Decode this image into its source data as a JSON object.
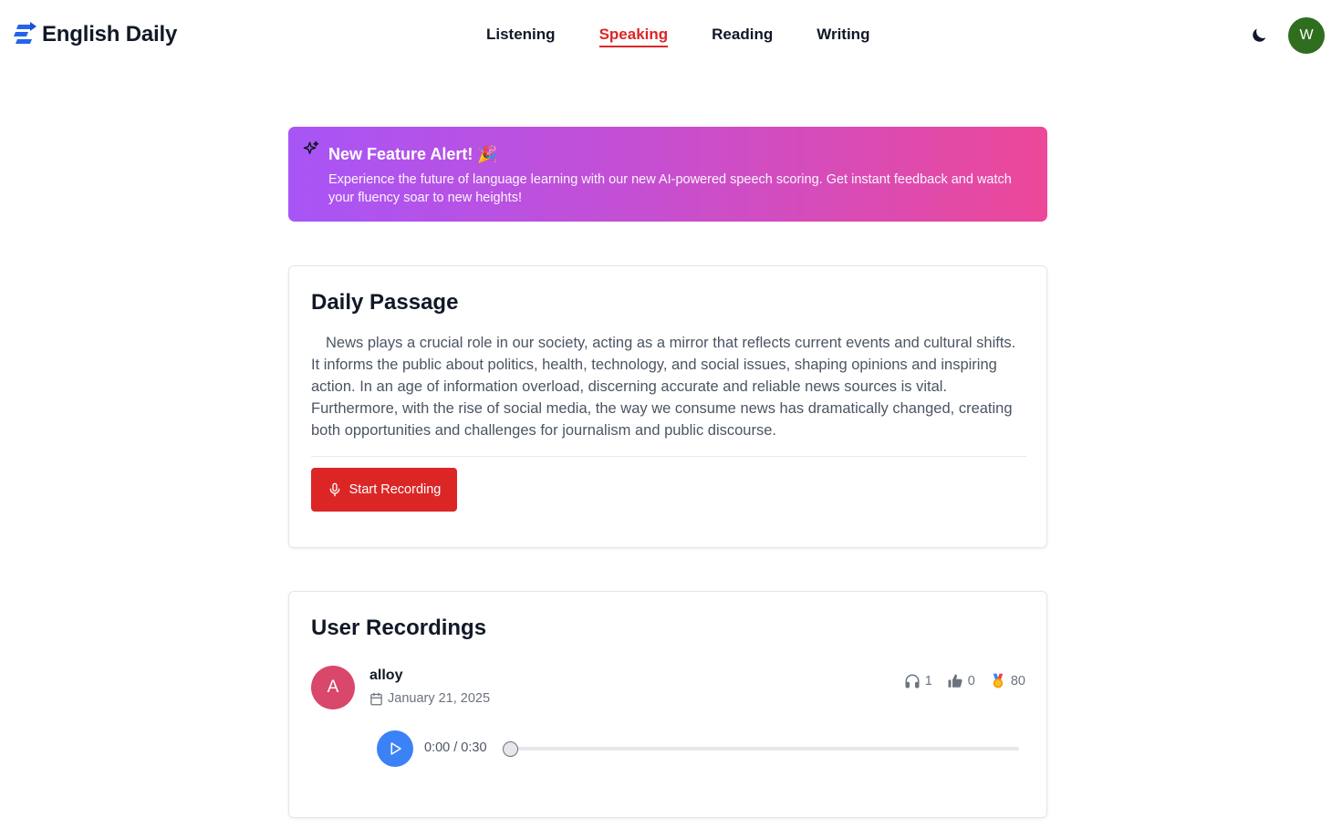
{
  "header": {
    "brand": "English Daily",
    "nav": [
      {
        "label": "Listening",
        "active": false
      },
      {
        "label": "Speaking",
        "active": true
      },
      {
        "label": "Reading",
        "active": false
      },
      {
        "label": "Writing",
        "active": false
      }
    ],
    "user_initial": "W",
    "theme_icon": "moon-icon"
  },
  "banner": {
    "title": "New Feature Alert! 🎉",
    "text": "Experience the future of language learning with our new AI-powered speech scoring. Get instant feedback and watch your fluency soar to new heights!",
    "icon": "sparkles-icon"
  },
  "passage": {
    "title": "Daily Passage",
    "text": "News plays a crucial role in our society, acting as a mirror that reflects current events and cultural shifts. It informs the public about politics, health, technology, and social issues, shaping opinions and inspiring action. In an age of information overload, discerning accurate and reliable news sources is vital. Furthermore, with the rise of social media, the way we consume news has dramatically changed, creating both opportunities and challenges for journalism and public discourse.",
    "record_label": "Start Recording"
  },
  "recordings": {
    "title": "User Recordings",
    "items": [
      {
        "initial": "A",
        "user": "alloy",
        "date": "January 21, 2025",
        "listens": "1",
        "likes": "0",
        "score": "80",
        "player": {
          "time": "0:00 / 0:30",
          "progress": 0
        }
      }
    ]
  },
  "colors": {
    "accent": "#dc2626",
    "avatar_user": "#2f6e1f",
    "avatar_recording": "#d9476b",
    "play": "#3b82f6",
    "banner_start": "#a855f7",
    "banner_end": "#ec4899"
  }
}
